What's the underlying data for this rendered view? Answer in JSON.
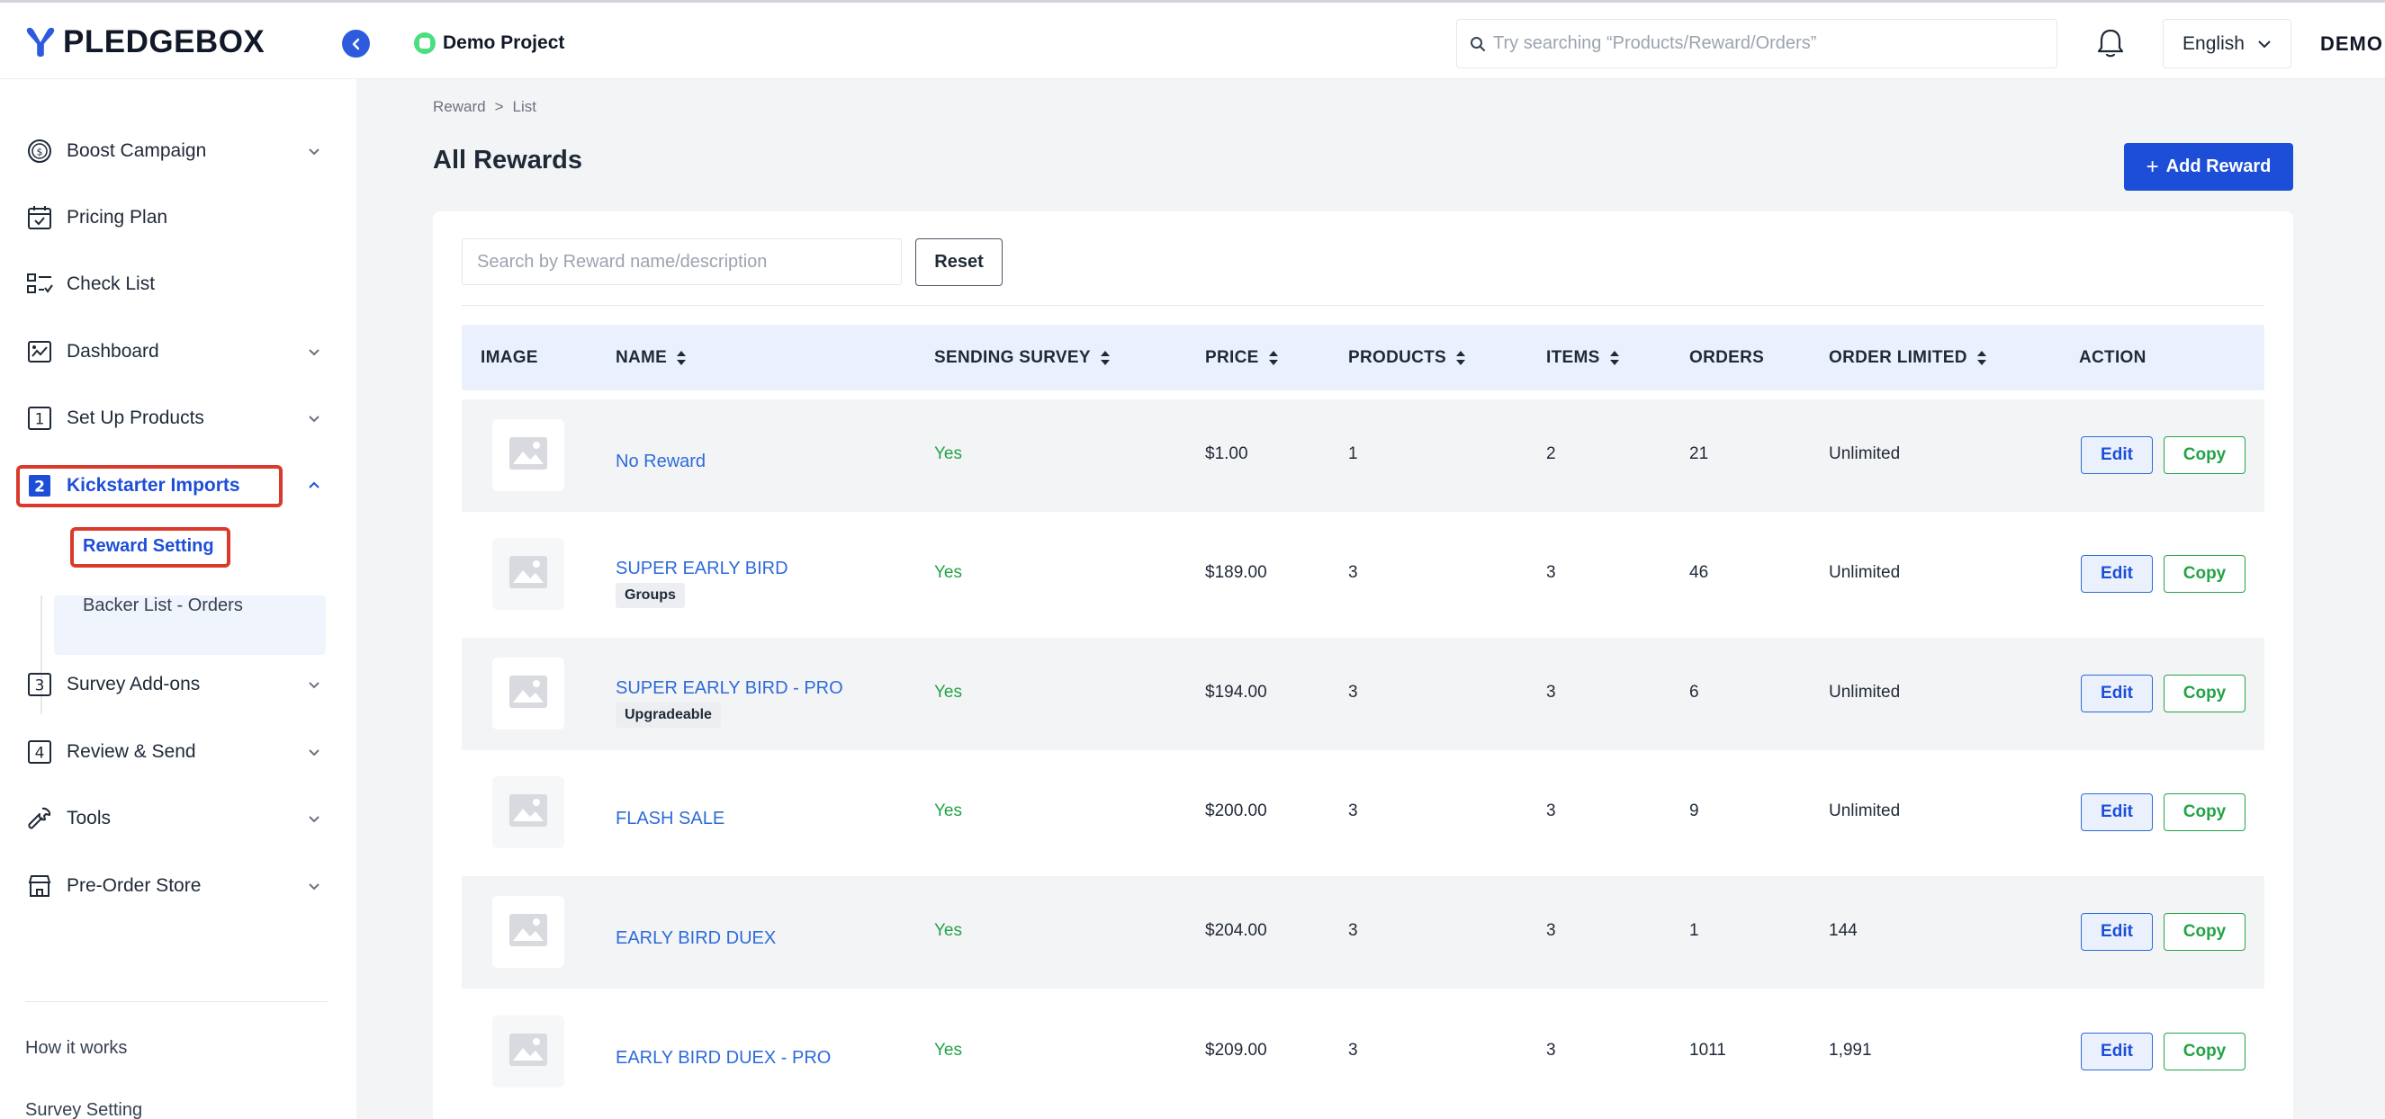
{
  "header": {
    "logo_text": "PLEDGEBOX",
    "project_name": "Demo Project",
    "search_placeholder": "Try searching “Products/Reward/Orders”",
    "language": "English",
    "user": "DEMO"
  },
  "sidebar": {
    "items": [
      {
        "label": "Boost Campaign",
        "icon": "dollar-circle-icon",
        "has_chevron": true
      },
      {
        "label": "Pricing Plan",
        "icon": "calendar-check-icon",
        "has_chevron": false
      },
      {
        "label": "Check List",
        "icon": "checklist-icon",
        "has_chevron": false
      },
      {
        "label": "Dashboard",
        "icon": "chart-icon",
        "has_chevron": true
      },
      {
        "label": "Set Up Products",
        "icon": "number-1-icon",
        "has_chevron": true
      },
      {
        "label": "Kickstarter Imports",
        "icon": "number-2-icon",
        "has_chevron": true,
        "active": true
      },
      {
        "label": "Survey Add-ons",
        "icon": "number-3-icon",
        "has_chevron": true
      },
      {
        "label": "Review & Send",
        "icon": "number-4-icon",
        "has_chevron": true
      },
      {
        "label": "Tools",
        "icon": "wrench-icon",
        "has_chevron": true
      },
      {
        "label": "Pre-Order Store",
        "icon": "store-icon",
        "has_chevron": true
      }
    ],
    "sub_items": [
      {
        "label": "Reward Setting",
        "active": true
      },
      {
        "label": "Backer List - Orders"
      }
    ],
    "icon_numbers": [
      "1",
      "2",
      "3",
      "4"
    ],
    "bottom_links": [
      "How it works",
      "Survey Setting"
    ]
  },
  "main": {
    "breadcrumb": [
      "Reward",
      ">",
      "List"
    ],
    "title": "All Rewards",
    "add_button": "Add Reward",
    "add_button_icon": "+",
    "filter_placeholder": "Search by Reward name/description",
    "reset_button": "Reset",
    "columns": [
      "IMAGE",
      "NAME",
      "SENDING SURVEY",
      "PRICE",
      "PRODUCTS",
      "ITEMS",
      "ORDERS",
      "ORDER LIMITED",
      "ACTION"
    ],
    "rows": [
      {
        "name": "No Reward",
        "tag": "",
        "survey": "Yes",
        "price": "$1.00",
        "products": "1",
        "items": "2",
        "orders": "21",
        "limited": "Unlimited"
      },
      {
        "name": "SUPER EARLY BIRD",
        "tag": "Groups",
        "survey": "Yes",
        "price": "$189.00",
        "products": "3",
        "items": "3",
        "orders": "46",
        "limited": "Unlimited"
      },
      {
        "name": "SUPER EARLY BIRD - PRO",
        "tag": "Upgradeable",
        "survey": "Yes",
        "price": "$194.00",
        "products": "3",
        "items": "3",
        "orders": "6",
        "limited": "Unlimited"
      },
      {
        "name": "FLASH SALE",
        "tag": "",
        "survey": "Yes",
        "price": "$200.00",
        "products": "3",
        "items": "3",
        "orders": "9",
        "limited": "Unlimited"
      },
      {
        "name": "EARLY BIRD DUEX",
        "tag": "",
        "survey": "Yes",
        "price": "$204.00",
        "products": "3",
        "items": "3",
        "orders": "1",
        "limited": "144"
      },
      {
        "name": "EARLY BIRD DUEX - PRO",
        "tag": "",
        "survey": "Yes",
        "price": "$209.00",
        "products": "3",
        "items": "3",
        "orders": "1011",
        "limited": "1,991"
      }
    ],
    "edit_label": "Edit",
    "copy_label": "Copy"
  },
  "colors": {
    "primary": "#1d4ed8",
    "link": "#2e6bd9",
    "success": "#22a447",
    "highlight": "#d93a2b",
    "table_header_bg": "#eaf1fd"
  }
}
